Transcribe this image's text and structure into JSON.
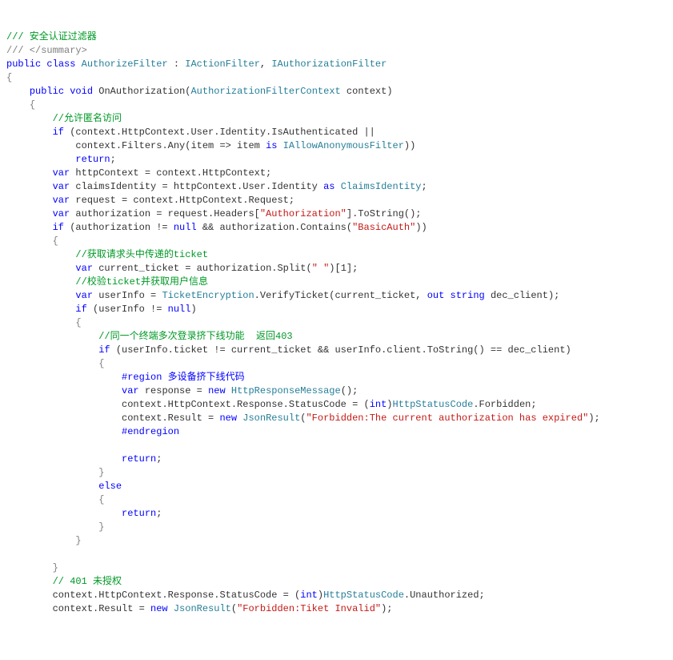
{
  "code": {
    "line01_hdr": "/// 安全认证过滤器",
    "line02_xml": "/// </summary>",
    "kw_public": "public",
    "kw_class": "class",
    "kw_void": "void",
    "kw_if": "if",
    "kw_return": "return",
    "kw_var": "var",
    "kw_null": "null",
    "kw_is": "is",
    "kw_as": "as",
    "kw_out": "out",
    "kw_string": "string",
    "kw_else": "else",
    "kw_new": "new",
    "kw_int": "int",
    "cls_AuthorizeFilter": "AuthorizeFilter",
    "cls_IActionFilter": "IActionFilter",
    "cls_IAuthorizationFilter": "IAuthorizationFilter",
    "cls_AuthorizationFilterContext": "AuthorizationFilterContext",
    "cls_IAllowAnonymousFilter": "IAllowAnonymousFilter",
    "cls_ClaimsIdentity": "ClaimsIdentity",
    "cls_TicketEncryption": "TicketEncryption",
    "cls_HttpResponseMessage": "HttpResponseMessage",
    "cls_HttpStatusCode": "HttpStatusCode",
    "cls_JsonResult": "JsonResult",
    "mth_OnAuthorization": "OnAuthorization",
    "cmt_allowAnon": "//允许匿名访问",
    "txt_l05a": " (context.HttpContext.User.Identity.IsAuthenticated ||",
    "txt_l06a": "context.Filters.Any(item => item ",
    "txt_l06b": "))",
    "txt_l08": " httpContext = context.HttpContext;",
    "txt_l09a": " claimsIdentity = httpContext.User.Identity ",
    "txt_l09b": ";",
    "txt_l10": " request = context.HttpContext.Request;",
    "txt_l11a": " authorization = request.Headers[",
    "txt_l11b": "].ToString();",
    "txt_l12a": " (authorization != ",
    "txt_l12b": " && authorization.Contains(",
    "txt_l12c": "))",
    "cmt_getTicket": "//获取请求头中传递的ticket",
    "txt_l14a": " current_ticket = authorization.Split(",
    "txt_l14b": ")[1];",
    "cmt_verifyTicket": "//校验ticket并获取用户信息",
    "txt_l16a": " userInfo = ",
    "txt_l16b": ".VerifyTicket(current_ticket, ",
    "txt_l16c": " dec_client);",
    "txt_l17a": " (userInfo != ",
    "txt_l17b": ")",
    "cmt_sameTerm": "//同一个终端多次登录挤下线功能  返回403",
    "txt_l19a": " (userInfo.ticket != current_ticket && userInfo.client.ToString() == dec_client)",
    "region_txt": "#region 多设备挤下线代码",
    "txt_l21a": " response = ",
    "txt_l21b": "();",
    "txt_l22a": "context.HttpContext.Response.StatusCode = (",
    "txt_l22b": ")",
    "txt_l22c": ".Forbidden;",
    "txt_l23a": "context.Result = ",
    "txt_l23b": "(",
    "txt_l23c": ");",
    "endregion": "#endregion",
    "cmt_401": "// 401 未授权",
    "txt_l30a": "context.HttpContext.Response.StatusCode = (",
    "txt_l30b": ")",
    "txt_l30c": ".Unauthorized;",
    "txt_l31a": "context.Result = ",
    "txt_l31b": "(",
    "txt_l31c": ");",
    "str_Authorization": "\"Authorization\"",
    "str_BasicAuth": "\"BasicAuth\"",
    "str_space": "\" \"",
    "str_forbiddenExpired": "\"Forbidden:The current authorization has expired\"",
    "str_forbiddenTiket": "\"Forbidden:Tiket Invalid\"",
    "br_open": "{",
    "br_close": "}",
    "ret_semi": ";"
  }
}
